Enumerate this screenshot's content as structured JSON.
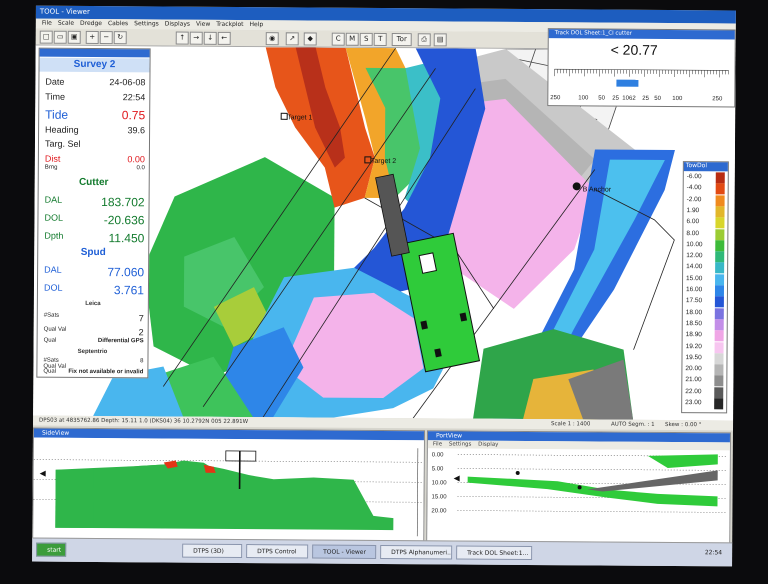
{
  "window": {
    "title": "TOOL - Viewer"
  },
  "menu": [
    "File",
    "Scale",
    "Dredge",
    "Cables",
    "Settings",
    "Displays",
    "View",
    "Trackplot",
    "Help"
  ],
  "toolbar": {
    "buttons": [
      "C",
      "M",
      "S",
      "T",
      "Tor"
    ]
  },
  "map": {
    "targets": [
      {
        "label": "Target 1"
      },
      {
        "label": "Target 2"
      },
      {
        "label": "B Anchor"
      }
    ]
  },
  "survey": {
    "title": "Survey 2",
    "date_label": "Date",
    "date": "24-06-08",
    "time_label": "Time",
    "time": "22:54",
    "tide_label": "Tide",
    "tide": "0.75",
    "heading_label": "Heading",
    "heading": "39.6",
    "targ_label": "Targ. Sel",
    "dist_label": "Dist",
    "dist": "0.00",
    "brng_label": "Brng",
    "brng": "0.0",
    "cutter_title": "Cutter",
    "dal_label": "DAL",
    "dal": "183.702",
    "dol_label": "DOL",
    "dol": "-20.636",
    "dpth_label": "Dpth",
    "dpth": "11.450",
    "spud_title": "Spud",
    "spud_dal_label": "DAL",
    "spud_dal": "77.060",
    "spud_dol_label": "DOL",
    "spud_dol": "3.761",
    "leica_title": "Leica",
    "sats_label": "#Sats",
    "sats": "7",
    "qual_val_label": "Qual Val",
    "qual_val": "2",
    "qual_label": "Qual",
    "qual": "Differential GPS",
    "sept_title": "Septentrio",
    "sept_sats_label": "#Sats",
    "sept_sats": "8",
    "sept_qual_val_label": "Qual Val",
    "sept_qual_label": "Qual",
    "sept_qual": "Fix not available or invalid"
  },
  "track": {
    "title": "Track DOL Sheet:1_Cl cutter",
    "value": "< 20.77",
    "scale": [
      "250",
      "100",
      "50",
      "25",
      "1062",
      "25",
      "50",
      "100",
      "250"
    ]
  },
  "legend": {
    "title": "TowDol",
    "items": [
      {
        "label": "-6.00",
        "color": "#b82c12"
      },
      {
        "label": "-4.00",
        "color": "#e24a13"
      },
      {
        "label": "-2.00",
        "color": "#f08a1e"
      },
      {
        "label": "1.90",
        "color": "#e2b72a"
      },
      {
        "label": "6.00",
        "color": "#d8d62b"
      },
      {
        "label": "8.00",
        "color": "#9bcc33"
      },
      {
        "label": "10.00",
        "color": "#3dbb3a"
      },
      {
        "label": "12.00",
        "color": "#2fb979"
      },
      {
        "label": "14.00",
        "color": "#38b8c7"
      },
      {
        "label": "15.00",
        "color": "#49b6ee"
      },
      {
        "label": "16.00",
        "color": "#2e86e8"
      },
      {
        "label": "17.50",
        "color": "#2456d6"
      },
      {
        "label": "18.00",
        "color": "#7a73e0"
      },
      {
        "label": "18.50",
        "color": "#c38ee8"
      },
      {
        "label": "18.90",
        "color": "#f0a6e6"
      },
      {
        "label": "19.20",
        "color": "#f7c6f0"
      },
      {
        "label": "19.50",
        "color": "#d7d7d7"
      },
      {
        "label": "20.00",
        "color": "#b5b5b5"
      },
      {
        "label": "21.00",
        "color": "#8d8d8d"
      },
      {
        "label": "22.00",
        "color": "#5a5a5a"
      },
      {
        "label": "23.00",
        "color": "#262626"
      }
    ]
  },
  "status": {
    "coords": "DPS03 at 4835762.86 Depth: 15.11 1.0 (DKS04) 36 10.2792N 005 22.891W",
    "scale": "Scale 1 : 1400",
    "auto": "AUTO Segm. : 1",
    "skew": "Skew : 0.00 °"
  },
  "sideview": {
    "title": "SideView"
  },
  "portview": {
    "title": "PortView",
    "menu": [
      "File",
      "Settings",
      "Display"
    ],
    "depths": [
      "0.00",
      "5.00",
      "10.00",
      "15.00",
      "20.00"
    ]
  },
  "taskbar": {
    "start": "start",
    "items": [
      "DTPS (3D)",
      "DTPS Control",
      "TOOL - Viewer",
      "DTPS Alphanumeri...",
      "Track DOL Sheet:1..."
    ],
    "clock": "22:54"
  }
}
